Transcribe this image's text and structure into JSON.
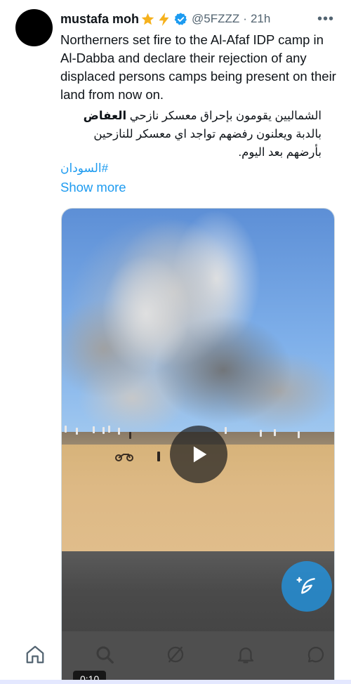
{
  "tweet": {
    "display_name": "mustafa moh",
    "handle": "@5FZZZ",
    "separator": "·",
    "time": "21h",
    "more_label": "•••",
    "text_en": "Northerners set fire to the Al-Afaf IDP camp in Al-Dabba and declare their rejection of any displaced persons camps being present on their land from now on.",
    "text_ar_before": "الشماليين يقومون بإحراق معسكر نازحي ",
    "text_ar_bold": "العفاض",
    "text_ar_after": " بالدبة ويعلنون رفضهم تواجد اي معسكر للنازحين بأرضهم بعد اليوم.",
    "hashtag": "#السودان",
    "show_more": "Show more"
  },
  "media": {
    "type": "video",
    "duration": "0:10",
    "play_icon": "play-icon"
  },
  "fab": {
    "icon": "compose-icon"
  },
  "nav": {
    "items": [
      {
        "icon": "home-icon"
      },
      {
        "icon": "search-icon"
      },
      {
        "icon": "grok-icon"
      },
      {
        "icon": "notifications-icon"
      },
      {
        "icon": "messages-icon"
      }
    ]
  },
  "colors": {
    "accent": "#1d9bf0",
    "text": "#0f1419",
    "secondary": "#536471",
    "verified": "#1d9bf0"
  }
}
